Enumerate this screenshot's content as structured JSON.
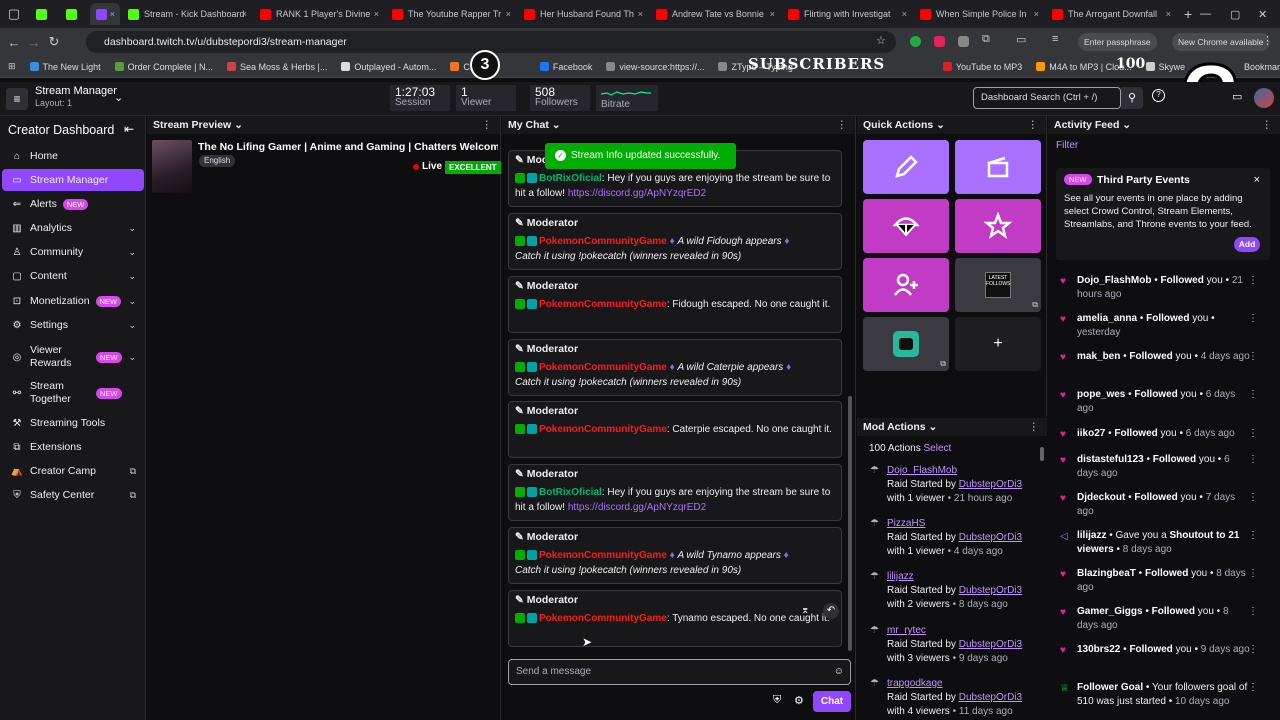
{
  "browser": {
    "tabs": [
      {
        "label": "",
        "color": "#53fc18"
      },
      {
        "label": "",
        "color": "#53fc18"
      },
      {
        "label": "",
        "color": "#9147ff"
      },
      {
        "label": "Stream - Kick Dashboard",
        "color": "#53fc18"
      },
      {
        "label": "RANK 1 Player's Divine",
        "color": "#ff0000"
      },
      {
        "label": "The Youtube Rapper Tr",
        "color": "#ff0000"
      },
      {
        "label": "Her Husband Found Th",
        "color": "#ff0000"
      },
      {
        "label": "Andrew Tate vs Bonnie",
        "color": "#ff0000"
      },
      {
        "label": "Flirting with Investigat",
        "color": "#ff0000"
      },
      {
        "label": "When Simple Police In",
        "color": "#ff0000"
      },
      {
        "label": "The Arrogant Downfall",
        "color": "#ff0000"
      }
    ],
    "new_tab": "+",
    "url": "dashboard.twitch.tv/u/dubstepordi3/stream-manager",
    "passphrase": "Enter passphrase",
    "chrome_update": "New Chrome available",
    "bookmarks": [
      "The New Light",
      "Order Complete | N...",
      "Sea Moss & Herbs |...",
      "Outplayed - Autom...",
      "Crunchyr",
      "Facebook",
      "view-source:https://...",
      "ZType – Typing",
      "YouTube to MP3",
      "M4A to MP3 | Clou...",
      "Skywe"
    ],
    "all_bookmarks": "Bookmarks"
  },
  "overlay": {
    "number": "3",
    "subscribers": "SUBSCRIBERS",
    "count": "100",
    "question": "?"
  },
  "topbar": {
    "title": "Stream Manager",
    "layout": "Layout: 1",
    "session_value": "1:27:03",
    "session_label": "Session",
    "viewer_value": "1",
    "viewer_label": "Viewer",
    "followers_value": "508",
    "followers_label": "Followers",
    "bitrate_label": "Bitrate",
    "search_placeholder": "Dashboard Search (Ctrl + /)"
  },
  "nav": {
    "title": "Creator Dashboard",
    "items": [
      {
        "label": "Home"
      },
      {
        "label": "Stream Manager"
      },
      {
        "label": "Alerts",
        "badge": "NEW"
      },
      {
        "label": "Analytics"
      },
      {
        "label": "Community"
      },
      {
        "label": "Content"
      },
      {
        "label": "Monetization",
        "badge": "NEW"
      },
      {
        "label": "Settings"
      },
      {
        "label": "Viewer\nRewards",
        "badge": "NEW"
      },
      {
        "label": "Stream\nTogether",
        "badge": "NEW"
      },
      {
        "label": "Streaming Tools"
      },
      {
        "label": "Extensions"
      },
      {
        "label": "Creator Camp"
      },
      {
        "label": "Safety Center"
      }
    ]
  },
  "preview": {
    "header": "Stream Preview",
    "title": "The No Lifing Gamer | Anime and Gaming | Chatters Welcomed |",
    "language": "English",
    "live": "Live",
    "quality": "EXCELLENT"
  },
  "chat": {
    "header": "My Chat",
    "toast": "Stream Info updated successfully.",
    "role": "Moderator",
    "messages": [
      {
        "user": "BotRixOficial",
        "text": ": Hey if you guys are enjoying the stream be sure to hit a follow! ",
        "link": "https://discord.gg/ApNYzqrED2"
      },
      {
        "user": "PokemonCommunityGame",
        "text": "A wild Fidough appears",
        "line2": "Catch it using !pokecatch (winners revealed in 90s)"
      },
      {
        "user": "PokemonCommunityGame",
        "text": ": Fidough escaped. No one caught it."
      },
      {
        "user": "PokemonCommunityGame",
        "text": "A wild Caterpie appears",
        "line2": "Catch it using !pokecatch (winners revealed in 90s)"
      },
      {
        "user": "PokemonCommunityGame",
        "text": ": Caterpie escaped. No one caught it."
      },
      {
        "user": "BotRixOficial",
        "text": ": Hey if you guys are enjoying the stream be sure to hit a follow! ",
        "link": "https://discord.gg/ApNYzqrED2"
      },
      {
        "user": "PokemonCommunityGame",
        "text": "A wild Tynamo appears",
        "line2": "Catch it using !pokecatch (winners revealed in 90s)"
      },
      {
        "user": "PokemonCommunityGame",
        "text": ": Tynamo escaped. No one caught it."
      }
    ],
    "input_placeholder": "Send a message",
    "send_label": "Chat"
  },
  "quick_actions": {
    "header": "Quick Actions",
    "latest_follows": "LATEST FOLLOWS",
    "add": "+"
  },
  "mod_actions": {
    "header": "Mod Actions",
    "count": "100 Actions",
    "select": "Select",
    "raid_prefix": "Raid Started by",
    "raider": "DubstepOrDi3",
    "items": [
      {
        "name": "Dojo_FlashMob",
        "viewers": "with 1 viewer",
        "time": "21 hours ago"
      },
      {
        "name": "PizzaHS",
        "viewers": "with 1 viewer",
        "time": "4 days ago"
      },
      {
        "name": "lilijazz",
        "viewers": "with 2 viewers",
        "time": "8 days ago"
      },
      {
        "name": "mr_rytec",
        "viewers": "with 3 viewers",
        "time": "9 days ago"
      },
      {
        "name": "trapgodkage",
        "viewers": "with 4 viewers",
        "time": "11 days ago"
      }
    ]
  },
  "activity": {
    "header": "Activity Feed",
    "filter": "Filter",
    "promo": {
      "badge": "NEW",
      "title": "Third Party Events",
      "body": "See all your events in one place by adding select Crowd Control, Stream Elements, Streamlabs, and Throne events to your feed.",
      "button": "Add"
    },
    "items": [
      {
        "name": "Dojo_FlashMob",
        "action": "Followed",
        "rest": "you",
        "time": "21 hours ago"
      },
      {
        "name": "amelia_anna",
        "action": "Followed",
        "rest": "you",
        "time": "yesterday"
      },
      {
        "name": "mak_ben",
        "action": "Followed",
        "rest": "you",
        "time": "4 days ago"
      },
      {
        "name": "pope_wes",
        "action": "Followed",
        "rest": "you",
        "time": "6 days ago"
      },
      {
        "name": "iiko27",
        "action": "Followed",
        "rest": "you",
        "time": "6 days ago"
      },
      {
        "name": "distasteful123",
        "action": "Followed",
        "rest": "you",
        "time": "6 days ago"
      },
      {
        "name": "Djdeckout",
        "action": "Followed",
        "rest": "you",
        "time": "7 days ago"
      },
      {
        "name": "lilijazz",
        "action": "Gave you a",
        "rest": "Shoutout to 21 viewers",
        "time": "8 days ago"
      },
      {
        "name": "BlazingbeaT",
        "action": "Followed",
        "rest": "you",
        "time": "8 days ago"
      },
      {
        "name": "Gamer_Giggs",
        "action": "Followed",
        "rest": "you",
        "time": "8 days ago"
      },
      {
        "name": "130brs22",
        "action": "Followed",
        "rest": "you",
        "time": "9 days ago"
      },
      {
        "name": "Follower Goal",
        "action": "",
        "rest": "Your followers goal of 510 was just started",
        "time": "10 days ago"
      }
    ]
  },
  "colors": {
    "accent": "#9147ff",
    "magenta": "#c13bc4",
    "purple": "#a970ff"
  }
}
